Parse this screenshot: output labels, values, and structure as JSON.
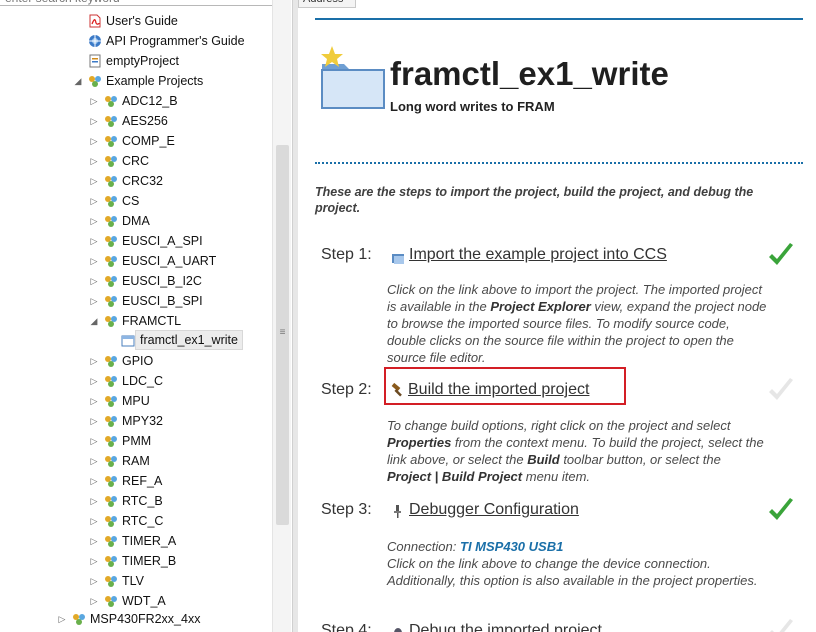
{
  "search": {
    "placeholder": "enter search keyword"
  },
  "tree": {
    "users_guide": "User's Guide",
    "api_guide": "API Programmer's Guide",
    "empty_project": "emptyProject",
    "example_projects": "Example Projects",
    "items": [
      "ADC12_B",
      "AES256",
      "COMP_E",
      "CRC",
      "CRC32",
      "CS",
      "DMA",
      "EUSCI_A_SPI",
      "EUSCI_A_UART",
      "EUSCI_B_I2C",
      "EUSCI_B_SPI",
      "FRAMCTL"
    ],
    "framctl_child": "framctl_ex1_write",
    "items_after": [
      "GPIO",
      "LDC_C",
      "MPU",
      "MPY32",
      "PMM",
      "RAM",
      "REF_A",
      "RTC_B",
      "RTC_C",
      "TIMER_A",
      "TIMER_B",
      "TLV",
      "WDT_A"
    ],
    "bottom_node": "MSP430FR2xx_4xx"
  },
  "address_tab": "Address",
  "page": {
    "title": "framctl_ex1_write",
    "subtitle": "Long word writes to FRAM",
    "intro": "These are the steps to import the project, build the project, and debug the project.",
    "step1": {
      "label": "Step 1:",
      "link": "Import the example project into CCS",
      "desc_pre": "Click on the link above to import the project. The imported project is available in the ",
      "desc_bold": "Project Explorer",
      "desc_post": " view, expand the project node to browse the imported source files. To modify source code, double clicks on the source file within the project to open the source file editor."
    },
    "step2": {
      "label": "Step 2:",
      "link": "Build the imported project",
      "desc_a": "To change build options, right click on the project and select ",
      "desc_b": "Properties",
      "desc_c": " from the context menu. To build the project, select the link above, or select the ",
      "desc_d": "Build",
      "desc_e": " toolbar button, or select the ",
      "desc_f": "Project | Build Project",
      "desc_g": " menu item."
    },
    "step3": {
      "label": "Step 3:",
      "link": "Debugger Configuration",
      "conn_label": "Connection: ",
      "conn_value": "TI MSP430 USB1",
      "desc": "Click on the link above to change the device connection. Additionally, this option is also available in the project properties."
    },
    "step4": {
      "label": "Step 4:",
      "link": "Debug the imported project"
    }
  },
  "colors": {
    "accent": "#1a6fa8",
    "highlight_box": "#d31e25",
    "check_green": "#3aa43a",
    "check_gray": "#e6e6e6"
  }
}
